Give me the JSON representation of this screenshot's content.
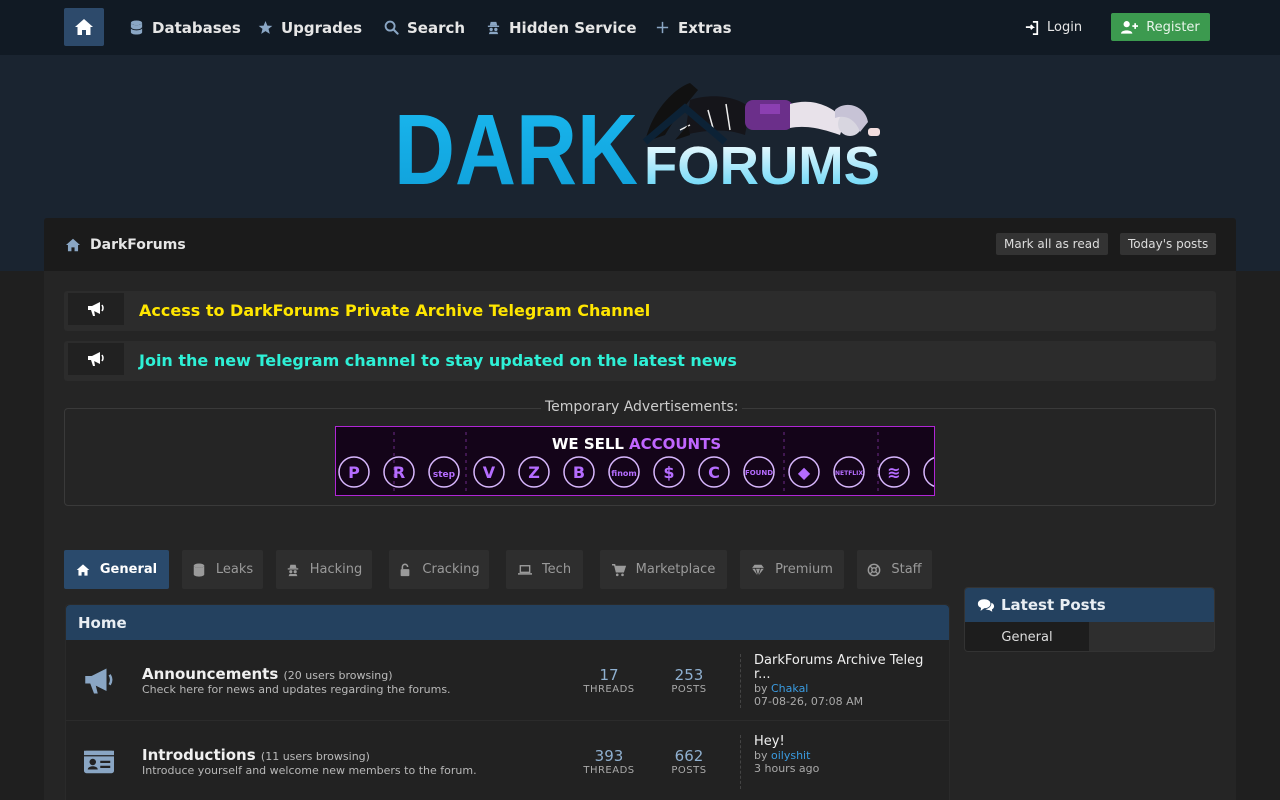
{
  "nav": {
    "items": [
      {
        "label": "Databases",
        "icon": "database-icon"
      },
      {
        "label": "Upgrades",
        "icon": "star-icon"
      },
      {
        "label": "Search",
        "icon": "search-icon"
      },
      {
        "label": "Hidden Service",
        "icon": "hidden-service-icon"
      },
      {
        "label": "Extras",
        "icon": "plus-icon"
      }
    ],
    "login_label": "Login",
    "register_label": "Register"
  },
  "logo": {
    "word1": "DARK",
    "word2": "FORUMS"
  },
  "breadcrumb": {
    "label": "DarkForums",
    "mark_read_label": "Mark all as read",
    "todays_posts_label": "Today's posts"
  },
  "announcements": [
    {
      "text": "Access to DarkForums Private Archive Telegram Channel",
      "color": "#ffe600"
    },
    {
      "text": "Join the new Telegram channel to stay updated on the latest news",
      "color": "#2ef0d6"
    }
  ],
  "ads": {
    "legend": "Temporary Advertisements:",
    "banner_text_1": "WE SELL",
    "banner_text_2": "ACCOUNTS"
  },
  "tabs": [
    {
      "label": "General",
      "active": true
    },
    {
      "label": "Leaks",
      "active": false
    },
    {
      "label": "Hacking",
      "active": false
    },
    {
      "label": "Cracking",
      "active": false
    },
    {
      "label": "Tech",
      "active": false
    },
    {
      "label": "Marketplace",
      "active": false
    },
    {
      "label": "Premium",
      "active": false
    },
    {
      "label": "Staff",
      "active": false
    }
  ],
  "forum_section": {
    "title": "Home",
    "forums": [
      {
        "name": "Announcements",
        "browsing": "(20 users browsing)",
        "description": "Check here for news and updates regarding the forums.",
        "threads": "17",
        "threads_label": "THREADS",
        "posts": "253",
        "posts_label": "POSTS",
        "last_title": "DarkForums Archive Teleg r...",
        "last_by_prefix": "by",
        "last_user": "Chakal",
        "last_time": "07-08-26, 07:08 AM"
      },
      {
        "name": "Introductions",
        "browsing": "(11 users browsing)",
        "description": "Introduce yourself and welcome new members to the forum.",
        "threads": "393",
        "threads_label": "THREADS",
        "posts": "662",
        "posts_label": "POSTS",
        "last_title": "Hey!",
        "last_by_prefix": "by",
        "last_user": "oilyshit",
        "last_time": "3 hours ago"
      }
    ]
  },
  "latest_posts": {
    "title": "Latest Posts",
    "tab_label": "General"
  }
}
